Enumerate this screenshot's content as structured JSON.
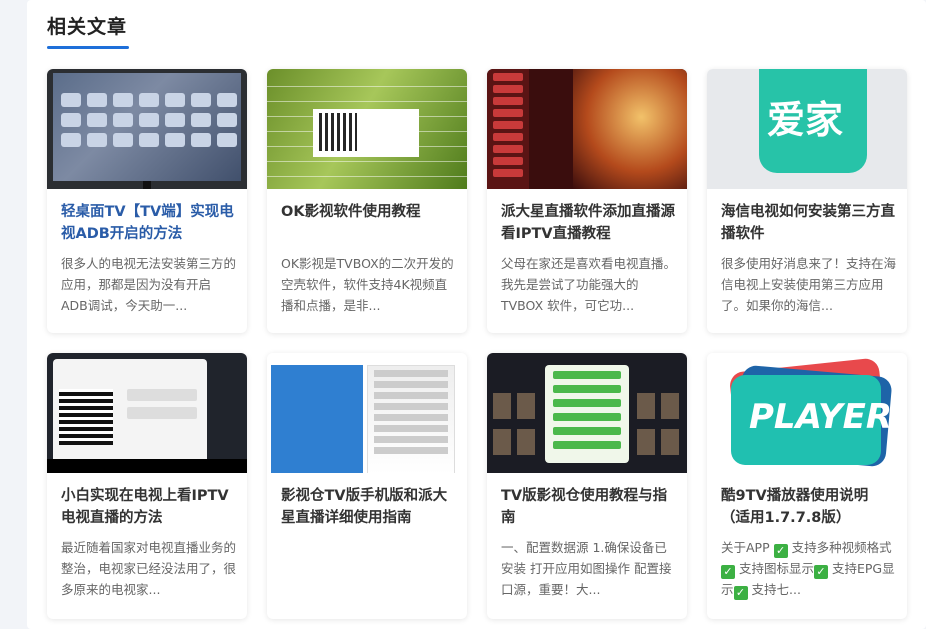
{
  "section": {
    "title": "相关文章"
  },
  "cards": [
    {
      "title": "轻桌面TV【TV端】实现电视ADB开启的方法",
      "desc": "很多人的电视无法安装第三方的应用，那都是因为没有开启ADB调试，今天助一..."
    },
    {
      "title": "OK影视软件使用教程",
      "desc": "OK影视是TVBOX的二次开发的空壳软件，软件支持4K视频直播和点播，是非..."
    },
    {
      "title": "派大星直播软件添加直播源看IPTV直播教程",
      "desc": "父母在家还是喜欢看电视直播。我先是尝试了功能强大的TVBOX 软件，可它功..."
    },
    {
      "title": "海信电视如何安装第三方直播软件",
      "desc": "很多使用好消息来了！支持在海信电视上安装使用第三方应用了。如果你的海信..."
    },
    {
      "title": "小白实现在电视上看IPTV电视直播的方法",
      "desc": "最近随着国家对电视直播业务的整治，电视家已经没法用了，很多原来的电视家..."
    },
    {
      "title": "影视仓TV版手机版和派大星直播详细使用指南",
      "desc": ""
    },
    {
      "title": "TV版影视仓使用教程与指南",
      "desc": "一、配置数据源 1.确保设备已安装 打开应用如图操作 配置接口源，重要！大..."
    },
    {
      "title": "酷9TV播放器使用说明（适用1.7.7.8版）",
      "desc_parts": [
        "关于APP",
        "支持多种视频格式",
        "支持图标显示",
        "支持EPG显示",
        "支持七..."
      ]
    }
  ],
  "thumbs": {
    "aijia_text": "爱家",
    "player_text": "PLAYER"
  },
  "colors": {
    "accent": "#1e6fd9",
    "title_active": "#2a5ca8"
  }
}
